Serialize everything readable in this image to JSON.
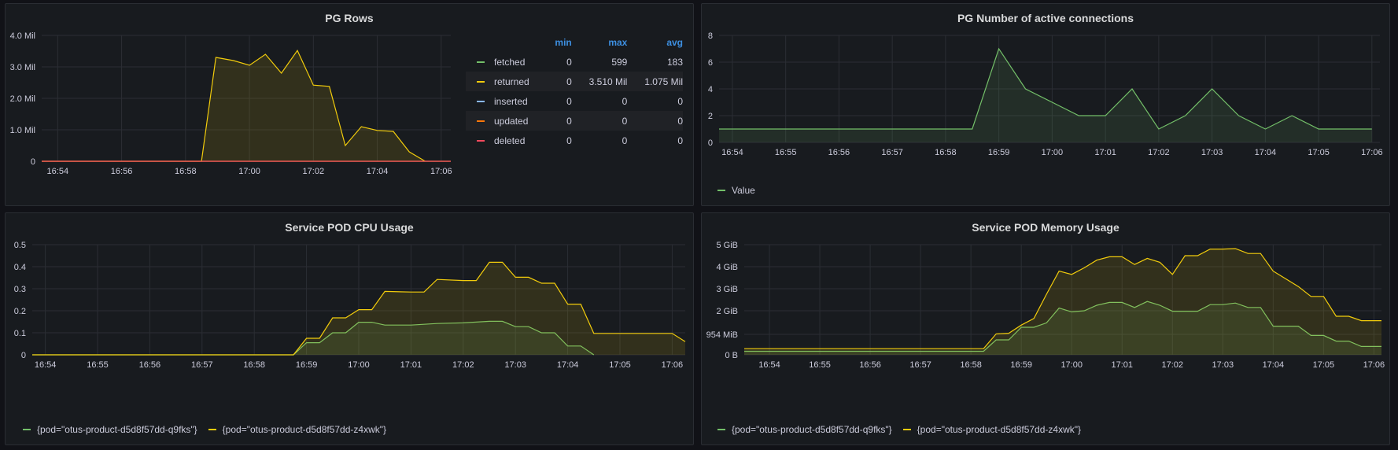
{
  "panels": {
    "pg_rows": {
      "title": "PG Rows"
    },
    "pg_conn": {
      "title": "PG Number of active connections"
    },
    "cpu": {
      "title": "Service POD CPU Usage"
    },
    "mem": {
      "title": "Service POD Memory Usage"
    }
  },
  "legend_table": {
    "headers": [
      "min",
      "max",
      "avg"
    ],
    "rows": [
      {
        "name": "fetched",
        "color": "#73bf69",
        "min": "0",
        "max": "599",
        "avg": "183"
      },
      {
        "name": "returned",
        "color": "#f2cc0c",
        "min": "0",
        "max": "3.510 Mil",
        "avg": "1.075 Mil"
      },
      {
        "name": "inserted",
        "color": "#8ab8ff",
        "min": "0",
        "max": "0",
        "avg": "0"
      },
      {
        "name": "updated",
        "color": "#ff780a",
        "min": "0",
        "max": "0",
        "avg": "0"
      },
      {
        "name": "deleted",
        "color": "#f2495c",
        "min": "0",
        "max": "0",
        "avg": "0"
      }
    ]
  },
  "chart_data": [
    {
      "id": "pg_rows",
      "type": "area",
      "title": "PG Rows",
      "ylim": [
        0,
        4000000
      ],
      "yticks": [
        0,
        1000000,
        2000000,
        3000000,
        4000000
      ],
      "ytick_labels": [
        "0",
        "1.0 Mil",
        "2.0 Mil",
        "3.0 Mil",
        "4.0 Mil"
      ],
      "xlim": [
        "16:53.5",
        "17:06.3"
      ],
      "xticks": [
        "16:54",
        "16:56",
        "16:58",
        "17:00",
        "17:02",
        "17:04",
        "17:06"
      ],
      "legend": "right-table",
      "series": [
        {
          "name": "returned",
          "color": "#f2cc0c",
          "fill": true,
          "x": [
            "16:53.5",
            "16:58.5",
            "16:58.95",
            "16:59.5",
            "17:00",
            "17:00.5",
            "17:01",
            "17:01.5",
            "17:02",
            "17:02.5",
            "17:03",
            "17:03.5",
            "17:04",
            "17:04.5",
            "17:05",
            "17:05.5"
          ],
          "y": [
            0,
            0,
            3300000,
            3200000,
            3050000,
            3400000,
            2800000,
            3520000,
            2420000,
            2380000,
            500000,
            1100000,
            980000,
            950000,
            300000,
            0
          ]
        },
        {
          "name": "fetched",
          "color": "#73bf69",
          "fill": false,
          "x": [
            "16:53.5",
            "17:06.3"
          ],
          "y": [
            0,
            0
          ]
        },
        {
          "name": "updated",
          "color": "#ff780a",
          "fill": false,
          "x": [
            "16:53.5",
            "17:06.3"
          ],
          "y": [
            0,
            0
          ]
        },
        {
          "name": "deleted",
          "color": "#f2495c",
          "fill": false,
          "x": [
            "16:53.5",
            "17:06.3"
          ],
          "y": [
            0,
            0
          ]
        }
      ]
    },
    {
      "id": "pg_conn",
      "type": "area",
      "title": "PG Number of active connections",
      "ylim": [
        0,
        8
      ],
      "yticks": [
        0,
        2,
        4,
        6,
        8
      ],
      "ytick_labels": [
        "0",
        "2",
        "4",
        "6",
        "8"
      ],
      "xlim": [
        "16:53.75",
        "17:06.15"
      ],
      "xticks": [
        "16:54",
        "16:55",
        "16:56",
        "16:57",
        "16:58",
        "16:59",
        "17:00",
        "17:01",
        "17:02",
        "17:03",
        "17:04",
        "17:05",
        "17:06"
      ],
      "legend": "bottom",
      "series": [
        {
          "name": "Value",
          "color": "#73bf69",
          "fill": true,
          "x": [
            "16:53.75",
            "16:58.5",
            "16:59",
            "16:59.5",
            "17:00",
            "17:00.5",
            "17:01",
            "17:01.5",
            "17:02",
            "17:02.5",
            "17:03",
            "17:03.5",
            "17:04",
            "17:04.5",
            "17:05",
            "17:05.5",
            "17:06"
          ],
          "y": [
            1,
            1,
            7,
            4,
            3,
            2,
            2,
            4,
            1,
            2,
            4,
            2,
            1,
            2,
            1,
            1,
            1
          ]
        }
      ]
    },
    {
      "id": "cpu",
      "type": "area",
      "title": "Service POD CPU Usage",
      "ylim": [
        0,
        0.5
      ],
      "yticks": [
        0,
        0.1,
        0.2,
        0.3,
        0.4,
        0.5
      ],
      "ytick_labels": [
        "0",
        "0.1",
        "0.2",
        "0.3",
        "0.4",
        "0.5"
      ],
      "xlim": [
        "16:53.75",
        "17:06.25"
      ],
      "xticks": [
        "16:54",
        "16:55",
        "16:56",
        "16:57",
        "16:58",
        "16:59",
        "17:00",
        "17:01",
        "17:02",
        "17:03",
        "17:04",
        "17:05",
        "17:06"
      ],
      "legend": "bottom",
      "series": [
        {
          "name": "{pod=\"otus-product-d5d8f57dd-q9fks\"}",
          "color": "#73bf69",
          "fill": true,
          "x": [
            "16:53.75",
            "16:58.75",
            "16:59",
            "16:59.25",
            "16:59.5",
            "16:59.75",
            "17:00",
            "17:00.25",
            "17:00.5",
            "17:01",
            "17:01.5",
            "17:02",
            "17:02.5",
            "17:02.75",
            "17:03",
            "17:03.25",
            "17:03.5",
            "17:03.75",
            "17:04",
            "17:04.25",
            "17:04.5"
          ],
          "y": [
            0,
            0,
            0.055,
            0.055,
            0.1,
            0.1,
            0.148,
            0.148,
            0.135,
            0.135,
            0.142,
            0.145,
            0.152,
            0.152,
            0.128,
            0.128,
            0.1,
            0.1,
            0.04,
            0.04,
            0
          ]
        },
        {
          "name": "{pod=\"otus-product-d5d8f57dd-z4xwk\"}",
          "color": "#f2cc0c",
          "fill": true,
          "x": [
            "16:53.75",
            "16:58.75",
            "16:59",
            "16:59.25",
            "16:59.5",
            "16:59.75",
            "17:00",
            "17:00.25",
            "17:00.5",
            "17:01",
            "17:01.25",
            "17:01.5",
            "17:02",
            "17:02.25",
            "17:02.5",
            "17:02.75",
            "17:03",
            "17:03.25",
            "17:03.5",
            "17:03.75",
            "17:04",
            "17:04.25",
            "17:04.5",
            "17:05",
            "17:05.5",
            "17:06",
            "17:06.25"
          ],
          "y": [
            0,
            0,
            0.075,
            0.075,
            0.168,
            0.168,
            0.205,
            0.205,
            0.288,
            0.285,
            0.285,
            0.342,
            0.337,
            0.337,
            0.42,
            0.42,
            0.352,
            0.352,
            0.325,
            0.325,
            0.23,
            0.23,
            0.097,
            0.097,
            0.097,
            0.097,
            0.06
          ]
        }
      ]
    },
    {
      "id": "mem",
      "type": "area",
      "title": "Service POD Memory Usage",
      "ylim": [
        0,
        5
      ],
      "yticks": [
        0,
        0.93,
        2,
        3,
        4,
        5
      ],
      "ytick_labels": [
        "0 B",
        "954 MiB",
        "2 GiB",
        "3 GiB",
        "4 GiB",
        "5 GiB"
      ],
      "xlim": [
        "16:53.5",
        "17:06.15"
      ],
      "xticks": [
        "16:54",
        "16:55",
        "16:56",
        "16:57",
        "16:58",
        "16:59",
        "17:00",
        "17:01",
        "17:02",
        "17:03",
        "17:04",
        "17:05",
        "17:06"
      ],
      "legend": "bottom",
      "series": [
        {
          "name": "{pod=\"otus-product-d5d8f57dd-q9fks\"}",
          "color": "#73bf69",
          "fill": true,
          "x": [
            "16:53.5",
            "16:58.25",
            "16:58.5",
            "16:58.75",
            "16:59",
            "16:59.25",
            "16:59.5",
            "16:59.75",
            "17:00",
            "17:00.25",
            "17:00.5",
            "17:00.75",
            "17:01",
            "17:01.25",
            "17:01.5",
            "17:01.75",
            "17:02",
            "17:02.25",
            "17:02.5",
            "17:02.75",
            "17:03",
            "17:03.25",
            "17:03.5",
            "17:03.75",
            "17:04",
            "17:04.25",
            "17:04.5",
            "17:04.75",
            "17:05",
            "17:05.25",
            "17:05.5",
            "17:05.75",
            "17:06",
            "17:06.15"
          ],
          "y": [
            0.16,
            0.16,
            0.68,
            0.68,
            1.25,
            1.25,
            1.45,
            2.12,
            1.95,
            2.0,
            2.25,
            2.38,
            2.38,
            2.15,
            2.42,
            2.25,
            1.98,
            1.98,
            1.98,
            2.28,
            2.28,
            2.35,
            2.15,
            2.15,
            1.3,
            1.3,
            1.3,
            0.88,
            0.88,
            0.62,
            0.62,
            0.38,
            0.38,
            0.38
          ]
        },
        {
          "name": "{pod=\"otus-product-d5d8f57dd-z4xwk\"}",
          "color": "#f2cc0c",
          "fill": true,
          "x": [
            "16:53.5",
            "16:58.25",
            "16:58.5",
            "16:58.75",
            "16:59",
            "16:59.25",
            "16:59.5",
            "16:59.75",
            "17:00",
            "17:00.25",
            "17:00.5",
            "17:00.75",
            "17:01",
            "17:01.25",
            "17:01.5",
            "17:01.75",
            "17:02",
            "17:02.25",
            "17:02.5",
            "17:02.75",
            "17:03",
            "17:03.25",
            "17:03.5",
            "17:03.75",
            "17:04",
            "17:04.25",
            "17:04.5",
            "17:04.75",
            "17:05",
            "17:05.25",
            "17:05.5",
            "17:05.75",
            "17:06",
            "17:06.15"
          ],
          "y": [
            0.28,
            0.28,
            0.95,
            0.98,
            1.35,
            1.65,
            2.75,
            3.8,
            3.65,
            3.95,
            4.3,
            4.45,
            4.45,
            4.1,
            4.38,
            4.2,
            3.65,
            4.5,
            4.5,
            4.8,
            4.8,
            4.82,
            4.6,
            4.6,
            3.8,
            3.45,
            3.1,
            2.65,
            2.65,
            1.75,
            1.75,
            1.55,
            1.55,
            1.55
          ]
        }
      ]
    }
  ]
}
